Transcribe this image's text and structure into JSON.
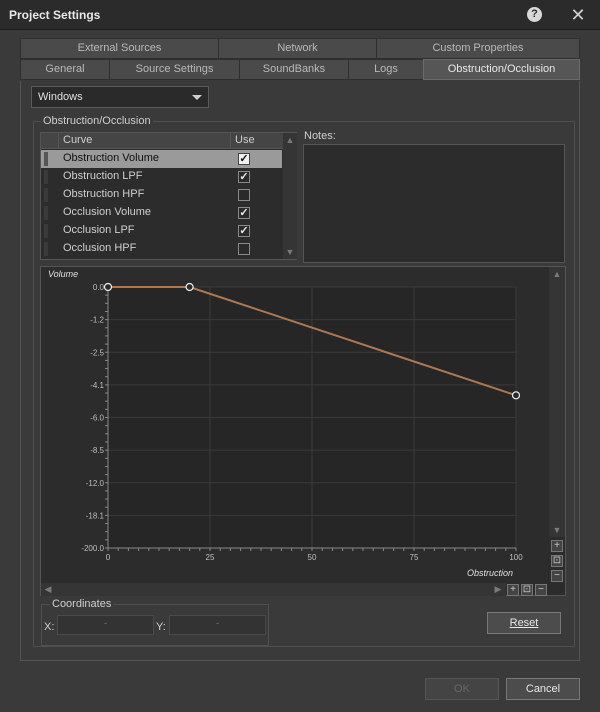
{
  "window": {
    "title": "Project Settings",
    "help_glyph": "?",
    "close_glyph": "✕"
  },
  "tabs": {
    "row1": [
      "External Sources",
      "Network",
      "Custom Properties"
    ],
    "row2": [
      "General",
      "Source Settings",
      "SoundBanks",
      "Logs",
      "Obstruction/Occlusion"
    ],
    "active": "Obstruction/Occlusion"
  },
  "platform": {
    "selected": "Windows"
  },
  "group": {
    "title": "Obstruction/Occlusion",
    "columns": [
      "Curve",
      "Use"
    ],
    "curves": [
      {
        "label": "Obstruction Volume",
        "use": true,
        "selected": true
      },
      {
        "label": "Obstruction LPF",
        "use": true,
        "selected": false
      },
      {
        "label": "Obstruction HPF",
        "use": false,
        "selected": false
      },
      {
        "label": "Occlusion Volume",
        "use": true,
        "selected": false
      },
      {
        "label": "Occlusion LPF",
        "use": true,
        "selected": false
      },
      {
        "label": "Occlusion HPF",
        "use": false,
        "selected": false
      }
    ],
    "notes_label": "Notes:"
  },
  "graph": {
    "y_axis_label": "Volume",
    "x_axis_label": "Obstruction",
    "y_ticks": [
      "0.0",
      "-1.2",
      "-2.5",
      "-4.1",
      "-6.0",
      "-8.5",
      "-12.0",
      "-18.1",
      "-200.0"
    ],
    "x_ticks": [
      "0",
      "25",
      "50",
      "75",
      "100"
    ],
    "points": [
      {
        "x": 0,
        "y_frac": 0.0
      },
      {
        "x": 20,
        "y_frac": 0.0
      },
      {
        "x": 100,
        "y_frac": 0.415
      }
    ],
    "curve_color": "#b07850",
    "scroll_up": "▲",
    "scroll_down": "▼",
    "scroll_left": "◀",
    "scroll_right": "▶",
    "zoom_in": "+",
    "zoom_fit": "⊡",
    "zoom_out": "−"
  },
  "coordinates": {
    "title": "Coordinates",
    "x_label": "X:",
    "y_label": "Y:",
    "x_value": "-",
    "y_value": "-"
  },
  "buttons": {
    "reset": "Reset",
    "ok": "OK",
    "cancel": "Cancel"
  }
}
